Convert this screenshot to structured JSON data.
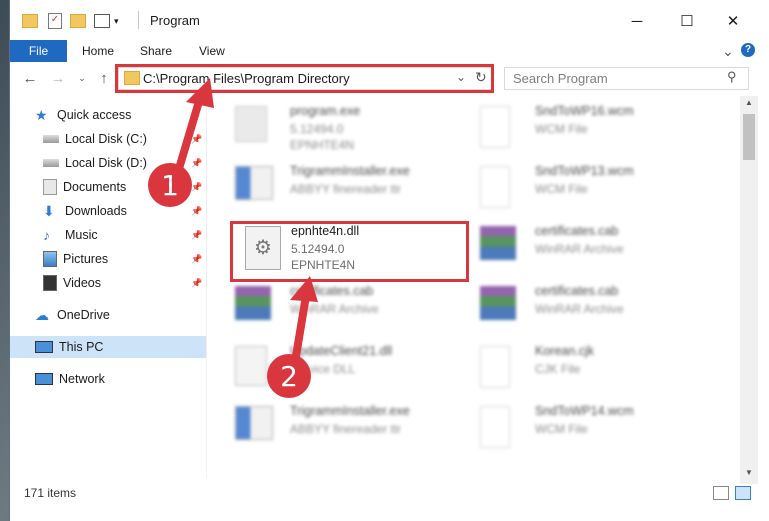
{
  "window": {
    "title": "Program",
    "controls": {
      "minimize": "─",
      "maximize": "☐",
      "close": "✕"
    }
  },
  "ribbon": {
    "file": "File",
    "home": "Home",
    "share": "Share",
    "view": "View",
    "chevron": "⌄",
    "help": "?"
  },
  "address": {
    "path": "C:\\Program Files\\Program Directory",
    "search_placeholder": "Search Program"
  },
  "nav": {
    "quick_access": "Quick access",
    "items": [
      {
        "label": "Local Disk (C:)",
        "icon": "drive-icon",
        "pinned": true
      },
      {
        "label": "Local Disk (D:)",
        "icon": "drive-icon",
        "pinned": true
      },
      {
        "label": "Documents",
        "icon": "documents-icon",
        "pinned": true
      },
      {
        "label": "Downloads",
        "icon": "downloads-icon",
        "pinned": true
      },
      {
        "label": "Music",
        "icon": "music-icon",
        "pinned": true
      },
      {
        "label": "Pictures",
        "icon": "pictures-icon",
        "pinned": true
      },
      {
        "label": "Videos",
        "icon": "videos-icon",
        "pinned": true
      }
    ],
    "onedrive": "OneDrive",
    "this_pc": "This PC",
    "network": "Network"
  },
  "files": [
    {
      "name": "program.exe",
      "type": "5.12494.0",
      "publisher": "EPNHTE4N",
      "icon": "exe-icon",
      "blurred": true
    },
    {
      "name": "SndToWP16.wcm",
      "type": "WCM File",
      "publisher": "",
      "icon": "file-icon",
      "blurred": true
    },
    {
      "name": "TrigrammInstaller.exe",
      "type": "ABBYY finereader ttr",
      "publisher": "",
      "icon": "installer-icon",
      "blurred": true
    },
    {
      "name": "SndToWP13.wcm",
      "type": "WCM File",
      "publisher": "",
      "icon": "file-icon",
      "blurred": true
    },
    {
      "name": "epnhte4n.dll",
      "type": "5.12494.0",
      "publisher": "EPNHTE4N",
      "icon": "dll-icon",
      "blurred": false
    },
    {
      "name": "certificates.cab",
      "type": "WinRAR Archive",
      "publisher": "",
      "icon": "archive-icon",
      "blurred": true
    },
    {
      "name": "certificates.cab",
      "type": "WinRAR Archive",
      "publisher": "",
      "icon": "archive-icon",
      "blurred": true
    },
    {
      "name": "certificates.cab",
      "type": "WinRAR Archive",
      "publisher": "",
      "icon": "archive-icon",
      "blurred": true
    },
    {
      "name": "UpdateClient21.dll",
      "type": "Service DLL",
      "publisher": "",
      "icon": "dll-icon",
      "blurred": true
    },
    {
      "name": "Korean.cjk",
      "type": "CJK File",
      "publisher": "",
      "icon": "file-icon",
      "blurred": true
    },
    {
      "name": "TrigrammInstaller.exe",
      "type": "ABBYY finereader ttr",
      "publisher": "",
      "icon": "installer-icon",
      "blurred": true
    },
    {
      "name": "SndToWP14.wcm",
      "type": "WCM File",
      "publisher": "",
      "icon": "file-icon",
      "blurred": true
    }
  ],
  "status": {
    "count": "171 items"
  },
  "annotations": {
    "step1": "1",
    "step2": "2",
    "color": "#d9363e"
  }
}
